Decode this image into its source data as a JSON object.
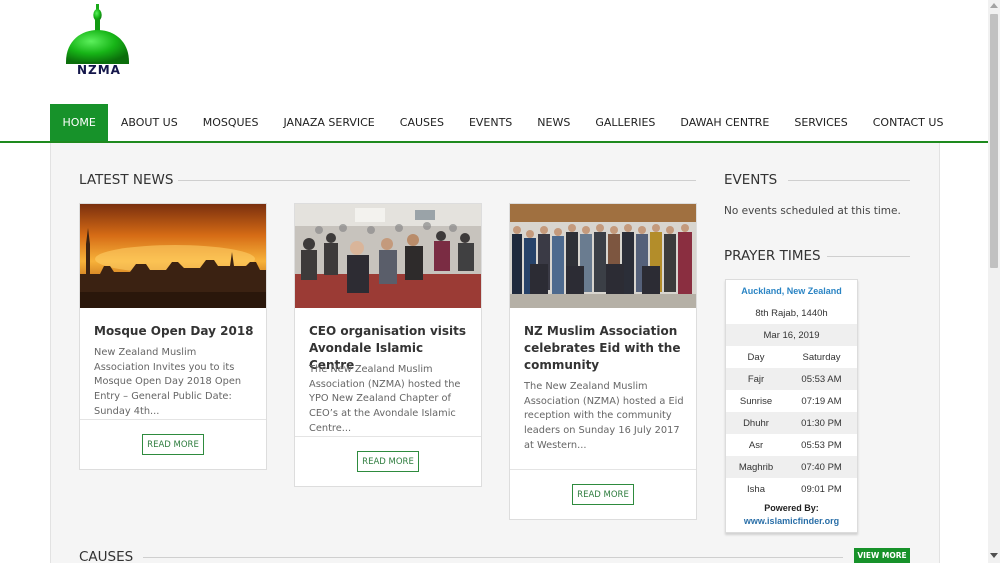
{
  "brand": {
    "logo_text": "NZMA",
    "accent_color": "#17922a"
  },
  "nav": {
    "items": [
      {
        "label": "HOME",
        "active": true
      },
      {
        "label": "ABOUT US"
      },
      {
        "label": "MOSQUES"
      },
      {
        "label": "JANAZA SERVICE"
      },
      {
        "label": "CAUSES"
      },
      {
        "label": "EVENTS"
      },
      {
        "label": "NEWS"
      },
      {
        "label": "GALLERIES"
      },
      {
        "label": "DAWAH CENTRE"
      },
      {
        "label": "SERVICES"
      },
      {
        "label": "CONTACT US"
      }
    ]
  },
  "latest_news": {
    "title": "LATEST NEWS",
    "articles": [
      {
        "title": "Mosque Open Day 2018",
        "excerpt": "New Zealand Muslim Association Invites you to its Mosque Open Day 2018 Open Entry – General Public Date: Sunday 4th...",
        "button": "READ MORE",
        "image": "sunset-city-mosque-silhouette"
      },
      {
        "title": "CEO organisation visits Avondale Islamic Centre",
        "excerpt": "The New Zealand Muslim Association (NZMA) hosted the YPO New Zealand Chapter of CEO’s at the Avondale Islamic Centre...",
        "button": "READ MORE",
        "image": "seated-audience-photo"
      },
      {
        "title": "NZ Muslim Association celebrates Eid with the community",
        "excerpt": "The New Zealand Muslim Association (NZMA) hosted a Eid reception with the community leaders on Sunday 16 July 2017 at Western...",
        "button": "READ MORE",
        "image": "group-photo"
      }
    ]
  },
  "events": {
    "title": "EVENTS",
    "message": "No events scheduled at this time."
  },
  "prayer_times": {
    "title": "PRAYER TIMES",
    "location": "Auckland, New Zealand",
    "hijri_date": "8th Rajab, 1440h",
    "date": "Mar 16, 2019",
    "day_label": "Day",
    "day_value": "Saturday",
    "rows": [
      {
        "name": "Fajr",
        "time": "05:53 AM"
      },
      {
        "name": "Sunrise",
        "time": "07:19 AM"
      },
      {
        "name": "Dhuhr",
        "time": "01:30 PM"
      },
      {
        "name": "Asr",
        "time": "05:53 PM"
      },
      {
        "name": "Maghrib",
        "time": "07:40 PM"
      },
      {
        "name": "Isha",
        "time": "09:01 PM"
      }
    ],
    "powered_by": "Powered By:",
    "powered_link": "www.islamicfinder.org"
  },
  "causes": {
    "title": "CAUSES",
    "view_more": "VIEW MORE"
  }
}
